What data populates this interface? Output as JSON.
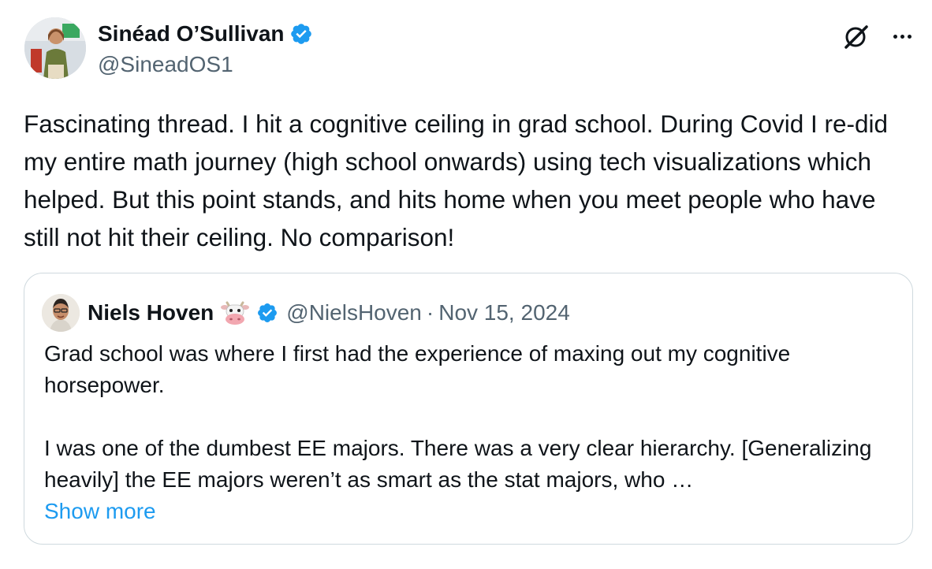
{
  "author": {
    "name": "Sinéad O’Sullivan",
    "handle": "@SineadOS1"
  },
  "tweet": {
    "text": "Fascinating thread. I hit a cognitive ceiling in grad school. During Covid I re-did my entire math journey (high school onwards) using tech visualizations which helped. But this point stands, and hits home when you meet people who have still not hit their ceiling. No comparison!"
  },
  "header_icons": [
    "grok-icon",
    "more-icon"
  ],
  "quoted": {
    "name": "Niels Hoven",
    "emoji": "🐮",
    "handle": "@NielsHoven",
    "separator": "·",
    "date": "Nov 15, 2024",
    "paragraph1": "Grad school was where I first had the experience of maxing out my cognitive horsepower.",
    "paragraph2": "I was one of the dumbest EE majors. There was a very clear hierarchy. [Generalizing heavily] the EE majors weren’t as smart as the stat majors, who …",
    "show_more": "Show more"
  },
  "colors": {
    "verified": "#1d9bf0",
    "link": "#1d9bf0",
    "secondary_text": "#536471",
    "border": "#cfd9de"
  }
}
